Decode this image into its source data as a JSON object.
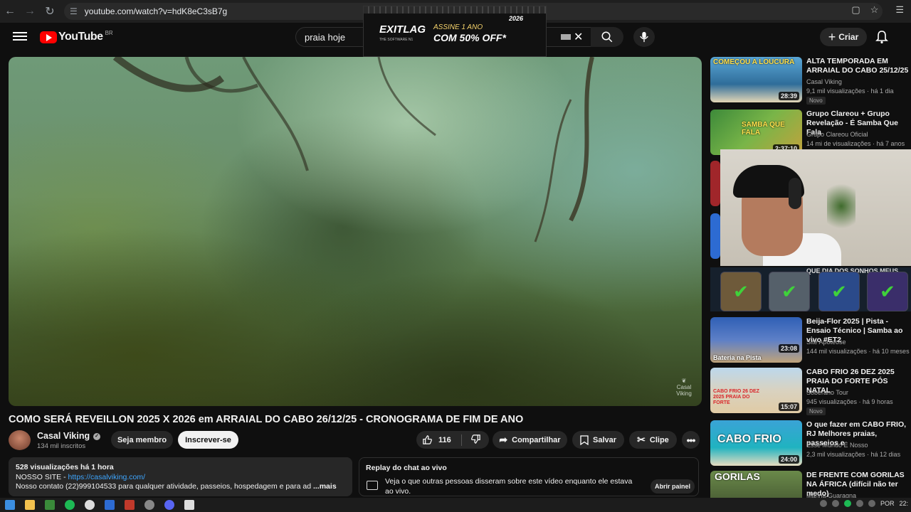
{
  "browser": {
    "url": "youtube.com/watch?v=hdK8eC3sB7g"
  },
  "header": {
    "logo_text": "YouTube",
    "country": "BR",
    "search_value": "praia hoje",
    "create_label": "Criar"
  },
  "ad": {
    "brand": "EXITLAG",
    "brand_sub": "THE SOFTWARE N1",
    "line1": "ASSINE 1 ANO",
    "line2": "COM 50% OFF*",
    "year": "2026"
  },
  "video": {
    "watermark": "Casal Viking",
    "title": "COMO SERÁ REVEILLON 2025 X 2026 em ARRAIAL DO CABO 26/12/25 - CRONOGRAMA DE FIM DE ANO",
    "channel_name": "Casal Viking",
    "subscribers": "134 mil inscritos",
    "join_label": "Seja membro",
    "subscribe_label": "Inscrever-se",
    "likes": "116",
    "share_label": "Compartilhar",
    "save_label": "Salvar",
    "clip_label": "Clipe"
  },
  "description": {
    "meta": "528 visualizações  há 1 hora",
    "site_prefix": "NOSSO SITE - ",
    "site_link": "https://casalviking.com/",
    "contact": "Nosso contato (22)999104533 para qualquer atividade, passeios, hospedagem e para ad",
    "more": "...mais"
  },
  "chat_replay": {
    "heading": "Replay do chat ao vivo",
    "text": "Veja o que outras pessoas disseram sobre este vídeo enquanto ele estava ao vivo.",
    "button": "Abrir painel"
  },
  "recommendations": [
    {
      "title": "ALTA TEMPORADA EM ARRAIAL DO CABO  25/12/25",
      "channel": "Casal Viking",
      "views": "9,1 mil visualizações  · há 1 dia",
      "duration": "28:39",
      "badge": "Novo",
      "thumb_text": "COMEÇOU A LOUCURA"
    },
    {
      "title": "Grupo Clareou + Grupo Revelação - É Samba Que Fala",
      "channel": "Grupo Clareou Oficial",
      "views": "14 mi de visualizações  · há 7 anos",
      "duration": "2:37:10",
      "badge": "",
      "thumb_text": "SAMBA QUE FALA"
    },
    {
      "title": "Beija-Flor 2025 | Pista - Ensaio Técnico |  Samba ao vivo #ET2",
      "channel": "Site Apoteose",
      "views": "144 mil visualizações  · há 10 meses",
      "duration": "23:08",
      "badge": "",
      "thumb_text": "Bateria na Pista"
    },
    {
      "title": "CABO FRIO 26 DEZ 2025 PRAIA DO FORTE  PÓS NATAL",
      "channel": "Soberano Tour",
      "views": "945 visualizações  · há 9 horas",
      "duration": "15:07",
      "badge": "Novo",
      "thumb_text": "CABO FRIO 26 DEZ 2025 PRAIA DO FORTE"
    },
    {
      "title": "O que fazer em CABO FRIO, RJ Melhores praias, passeios e",
      "channel": "Esse Mundo É Nosso",
      "views": "2,3 mil visualizações  · há 12 dias",
      "duration": "24:00",
      "badge": "",
      "thumb_text": "CABO FRIO"
    },
    {
      "title": "DE FRENTE COM GORILAS NA ÁFRICA (difícil não ter medo)",
      "channel": "Marina Guaragna",
      "views": "",
      "duration": "",
      "badge": "",
      "thumb_text": "GORILAS"
    }
  ],
  "overlay": {
    "achievement_caption": "QUE DIA DOS SONHOS MEUS"
  },
  "taskbar": {
    "lang": "POR",
    "time": "22:"
  }
}
